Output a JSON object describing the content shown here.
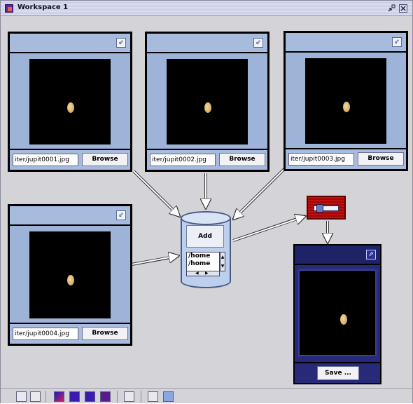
{
  "window": {
    "title": "Workspace 1",
    "minimize_icon": "minimize-icon",
    "close_icon": "close-icon"
  },
  "image_panels": [
    {
      "path": "iter/jupit0001.jpg",
      "browse_label": "Browse"
    },
    {
      "path": "iter/jupit0002.jpg",
      "browse_label": "Browse"
    },
    {
      "path": "iter/jupit0003.jpg",
      "browse_label": "Browse"
    },
    {
      "path": "iter/jupit0004.jpg",
      "browse_label": "Browse"
    }
  ],
  "collector": {
    "add_label": "Add",
    "list_items": [
      "/home",
      "/home"
    ]
  },
  "viewer": {
    "save_label": "Save ..."
  },
  "colors": {
    "panel_bg": "#9db3d8",
    "viewer_bg": "#262a78",
    "converter_red": "#c01010",
    "workspace_bg": "#d3d3d8"
  },
  "toolbar": {
    "tools": [
      "new-icon",
      "open-icon",
      "image-tool-icon",
      "import-tool-icon",
      "export-tool-icon",
      "filter-tool-icon",
      "draw-tool-icon",
      "grid-tool-icon",
      "shield-icon"
    ]
  }
}
